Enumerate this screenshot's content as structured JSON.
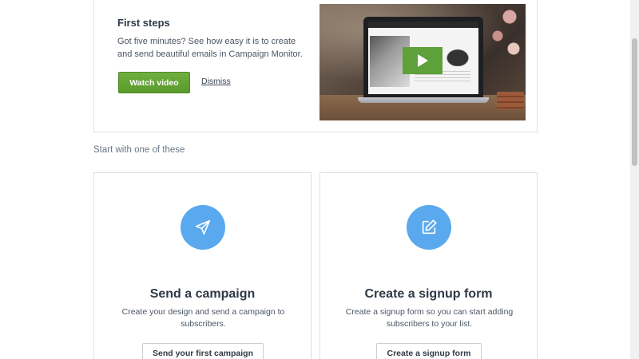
{
  "first_steps": {
    "title": "First steps",
    "description": "Got five minutes? See how easy it is to create and send beautiful emails in Campaign Monitor.",
    "watch_label": "Watch video",
    "dismiss_label": "Dismiss"
  },
  "section_label": "Start with one of these",
  "options": [
    {
      "icon": "paper-plane-icon",
      "title": "Send a campaign",
      "description": "Create your design and send a campaign to subscribers.",
      "button": "Send your first campaign"
    },
    {
      "icon": "edit-form-icon",
      "title": "Create a signup form",
      "description": "Create a signup form so you can start adding subscribers to your list.",
      "button": "Create a signup form"
    }
  ],
  "colors": {
    "primary_green": "#5ea03a",
    "icon_blue": "#5aa9ee",
    "text_dark": "#2f3a46",
    "border": "#dcdfe3"
  }
}
